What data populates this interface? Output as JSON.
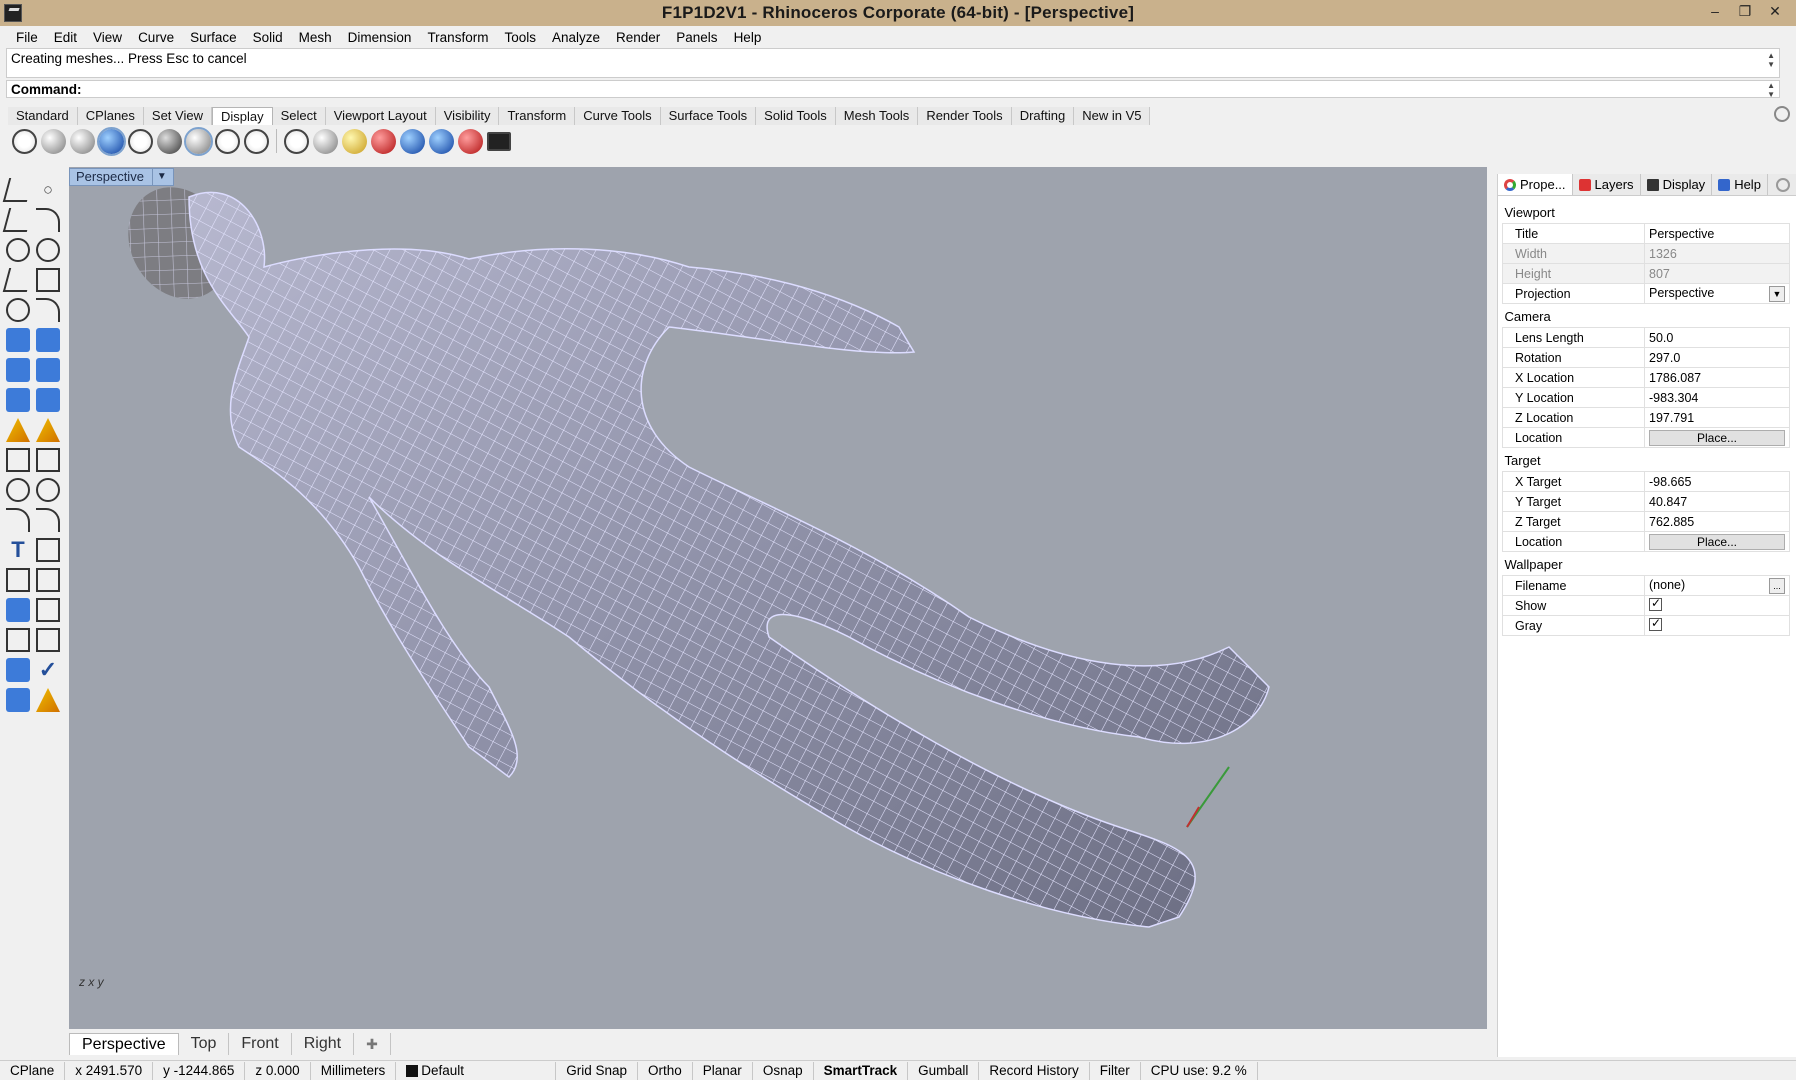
{
  "window": {
    "title": "F1P1D2V1 - Rhinoceros Corporate (64-bit) - [Perspective]"
  },
  "menu": [
    "File",
    "Edit",
    "View",
    "Curve",
    "Surface",
    "Solid",
    "Mesh",
    "Dimension",
    "Transform",
    "Tools",
    "Analyze",
    "Render",
    "Panels",
    "Help"
  ],
  "command": {
    "history": "Creating meshes... Press Esc to cancel",
    "prompt": "Command:"
  },
  "toolbar_tabs": [
    "Standard",
    "CPlanes",
    "Set View",
    "Display",
    "Select",
    "Viewport Layout",
    "Visibility",
    "Transform",
    "Curve Tools",
    "Surface Tools",
    "Solid Tools",
    "Mesh Tools",
    "Render Tools",
    "Drafting",
    "New in V5"
  ],
  "active_toolbar_tab": "Display",
  "viewport": {
    "label": "Perspective",
    "axes": "z  x y"
  },
  "viewport_tabs": [
    "Perspective",
    "Top",
    "Front",
    "Right"
  ],
  "right_panel": {
    "tabs": [
      "Prope...",
      "Layers",
      "Display",
      "Help"
    ],
    "sections": {
      "viewport": "Viewport",
      "camera": "Camera",
      "target": "Target",
      "wallpaper": "Wallpaper"
    },
    "rows": {
      "title_label": "Title",
      "title_value": "Perspective",
      "width_label": "Width",
      "width_value": "1326",
      "height_label": "Height",
      "height_value": "807",
      "projection_label": "Projection",
      "projection_value": "Perspective",
      "lens_label": "Lens Length",
      "lens_value": "50.0",
      "rotation_label": "Rotation",
      "rotation_value": "297.0",
      "xloc_label": "X Location",
      "xloc_value": "1786.087",
      "yloc_label": "Y Location",
      "yloc_value": "-983.304",
      "zloc_label": "Z Location",
      "zloc_value": "197.791",
      "location_label": "Location",
      "place_label": "Place...",
      "xtgt_label": "X Target",
      "xtgt_value": "-98.665",
      "ytgt_label": "Y Target",
      "ytgt_value": "40.847",
      "ztgt_label": "Z Target",
      "ztgt_value": "762.885",
      "filename_label": "Filename",
      "filename_value": "(none)",
      "browse_label": "...",
      "show_label": "Show",
      "gray_label": "Gray"
    }
  },
  "status": {
    "cplane": "CPlane",
    "x": "x 2491.570",
    "y": "y -1244.865",
    "z": "z 0.000",
    "units": "Millimeters",
    "layer": "Default",
    "grid_snap": "Grid Snap",
    "ortho": "Ortho",
    "planar": "Planar",
    "osnap": "Osnap",
    "smarttrack": "SmartTrack",
    "gumball": "Gumball",
    "record_history": "Record History",
    "filter": "Filter",
    "cpu": "CPU use: 9.2 %"
  },
  "colors": {
    "titlebar": "#c9b18c",
    "viewport_bg": "#9ea3ad",
    "wire": "#dcdcff",
    "mesh_fill": "#8e90a6"
  }
}
